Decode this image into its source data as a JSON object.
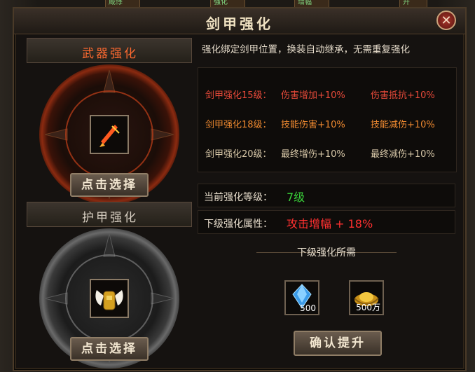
{
  "window": {
    "title": "剑甲强化",
    "close_glyph": "✕"
  },
  "weapon": {
    "header": "武器强化",
    "icon": "flame-sword-icon",
    "button": "点击选择"
  },
  "armor": {
    "header": "护甲强化",
    "icon": "golden-armor-icon",
    "button": "点击选择"
  },
  "description": "强化绑定剑甲位置，换装自动继承，无需重复强化",
  "attributes": [
    {
      "level": "剑甲强化15级：",
      "bonus1": "伤害增加+10%",
      "bonus2": "伤害抵抗+10%",
      "color": "#e84a3a"
    },
    {
      "level": "剑甲强化18级：",
      "bonus1": "技能伤害+10%",
      "bonus2": "技能减伤+10%",
      "color": "#f08a30"
    },
    {
      "level": "剑甲强化20级：",
      "bonus1": "最终增伤+10%",
      "bonus2": "最终减伤+10%",
      "color": "#d8c8a8"
    }
  ],
  "current": {
    "label": "当前强化等级：",
    "value": "7级",
    "value_color": "#3ad43a"
  },
  "next": {
    "label": "下级强化属性：",
    "value": "攻击增幅 + 18%",
    "value_color": "#ff3030"
  },
  "requirements": {
    "title": "下级强化所需",
    "items": [
      {
        "icon": "blue-crystal-icon",
        "qty": "500"
      },
      {
        "icon": "gold-ingot-icon",
        "qty": "500万"
      }
    ]
  },
  "confirm_button": "确认提升",
  "background_tags": [
    "威悸",
    "强化",
    "增幅",
    "升"
  ]
}
